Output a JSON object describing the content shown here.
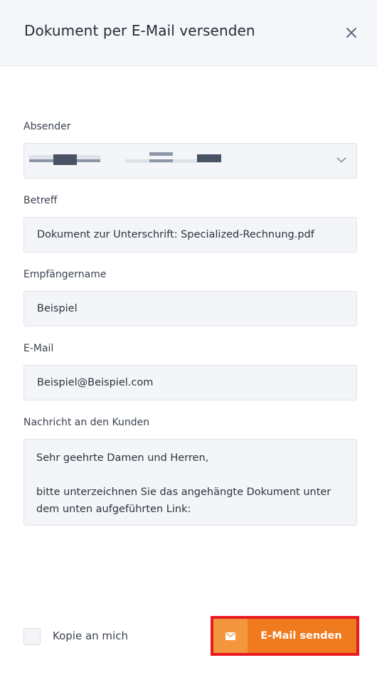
{
  "dialog": {
    "title": "Dokument per E-Mail versenden"
  },
  "fields": {
    "sender": {
      "label": "Absender"
    },
    "subject": {
      "label": "Betreff",
      "value": "Dokument zur Unterschrift: Specialized-Rechnung.pdf"
    },
    "recipient_name": {
      "label": "Empfängername",
      "value": "Beispiel"
    },
    "email": {
      "label": "E-Mail",
      "value": "Beispiel@Beispiel.com"
    },
    "message": {
      "label": "Nachricht an den Kunden",
      "value": "Sehr geehrte Damen und Herren,\n\nbitte unterzeichnen Sie das angehängte Dokument unter dem unten aufgeführten Link:"
    }
  },
  "footer": {
    "copy_label": "Kopie an mich",
    "copy_checked": false,
    "send_label": "E-Mail senden"
  },
  "icons": {
    "close": "close-icon",
    "dropdown": "chevron-down-icon",
    "send": "envelope-icon"
  },
  "colors": {
    "header_bg": "#f4f6fa",
    "field_bg": "#f4f5f9",
    "accent": "#f07a1e",
    "accent_light": "#f3963e",
    "highlight": "#e8191f"
  }
}
